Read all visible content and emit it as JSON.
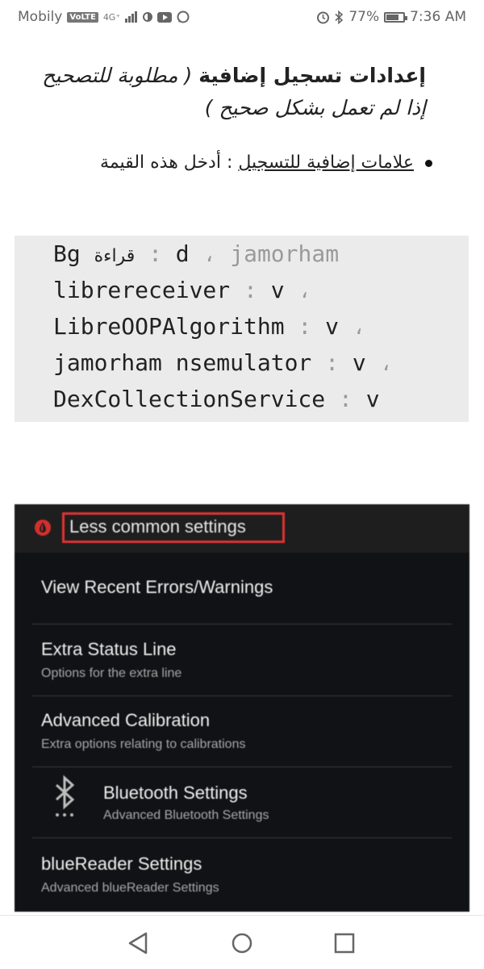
{
  "status_bar": {
    "carrier": "Mobily",
    "volte": "VoLTE",
    "network": "4G⁺",
    "battery": "77%",
    "battery_level": 0.77,
    "time": "7:36 AM",
    "icons": [
      "sim-icon",
      "signal-icon",
      "data-saver-icon",
      "youtube-icon",
      "whatsapp-icon",
      "alarm-icon",
      "bluetooth-icon",
      "battery-icon"
    ]
  },
  "article": {
    "heading_bold": "إعدادات تسجيل إضافية",
    "heading_rest": " ( مطلوبة للتصحيح إذا لم تعمل بشكل صحيح )",
    "bullet_link": "علامات إضافية للتسجيل",
    "bullet_text": " : أدخل هذه القيمة",
    "code_lines": [
      {
        "a": "Bg ",
        "ar": "قراءة",
        "sep": " : ",
        "b": "d",
        "tail": " ، jamorham"
      },
      {
        "a": "librereceiver",
        "ar": "",
        "sep": " : ",
        "b": "v",
        "tail": " ،"
      },
      {
        "a": "LibreOOPAlgorithm",
        "ar": "",
        "sep": " : ",
        "b": "v",
        "tail": " ،"
      },
      {
        "a": "jamorham nsemulator",
        "ar": "",
        "sep": " : ",
        "b": "v",
        "tail": " ،"
      },
      {
        "a": "DexCollectionService",
        "ar": "",
        "sep": " : ",
        "b": "v",
        "tail": ""
      }
    ]
  },
  "screenshot": {
    "title": "Less common settings",
    "items": [
      {
        "title": "View Recent Errors/Warnings",
        "subtitle": ""
      },
      {
        "title": "Extra Status Line",
        "subtitle": "Options for the extra line"
      },
      {
        "title": "Advanced Calibration",
        "subtitle": "Extra options relating to calibrations"
      },
      {
        "title": "Bluetooth Settings",
        "subtitle": "Advanced Bluetooth Settings"
      },
      {
        "title": "blueReader Settings",
        "subtitle": "Advanced blueReader Settings"
      }
    ],
    "colors": {
      "highlight": "#e03232",
      "background": "#111215",
      "app_icon": "#d32f2f"
    }
  },
  "nav_bar": {
    "buttons": [
      "back-button",
      "home-button",
      "recents-button"
    ]
  }
}
